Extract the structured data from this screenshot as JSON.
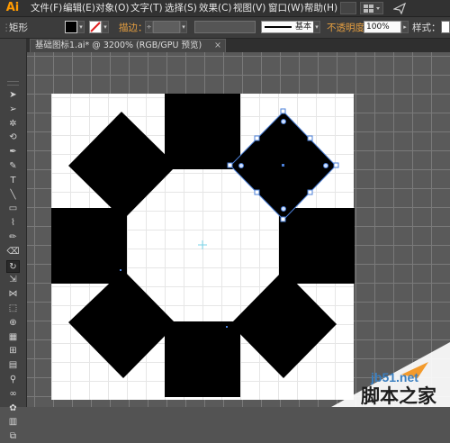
{
  "app": {
    "logo": "Ai"
  },
  "menu": {
    "items": [
      "文件(F)",
      "编辑(E)",
      "对象(O)",
      "文字(T)",
      "选择(S)",
      "效果(C)",
      "视图(V)",
      "窗口(W)",
      "帮助(H)"
    ]
  },
  "control": {
    "tool_name": "矩形",
    "stroke_label": "描边：",
    "stroke_style": "基本",
    "opacity_label": "不透明度：",
    "opacity_value": "100%",
    "style_label": "样式："
  },
  "document": {
    "tab_title": "基础图标1.ai* @ 3200% (RGB/GPU 预览)",
    "close_glyph": "×"
  },
  "tools": [
    "selection-tool",
    "direct-selection-tool",
    "magic-wand-tool",
    "lasso-tool",
    "pen-tool",
    "curvature-tool",
    "type-tool",
    "line-tool",
    "rectangle-tool",
    "paintbrush-tool",
    "pencil-tool",
    "eraser-tool",
    "rotate-tool",
    "scale-tool",
    "width-tool",
    "free-transform-tool",
    "shape-builder-tool",
    "perspective-grid-tool",
    "mesh-tool",
    "gradient-tool",
    "eyedropper-tool",
    "blend-tool",
    "symbol-sprayer-tool",
    "graph-tool",
    "artboard-tool"
  ],
  "colors": {
    "shape_fill": "#000000",
    "selection": "#4a7fd8",
    "center_mark": "#7ad4e8"
  },
  "watermark": {
    "site": "jb51.net",
    "name": "脚本之家"
  }
}
